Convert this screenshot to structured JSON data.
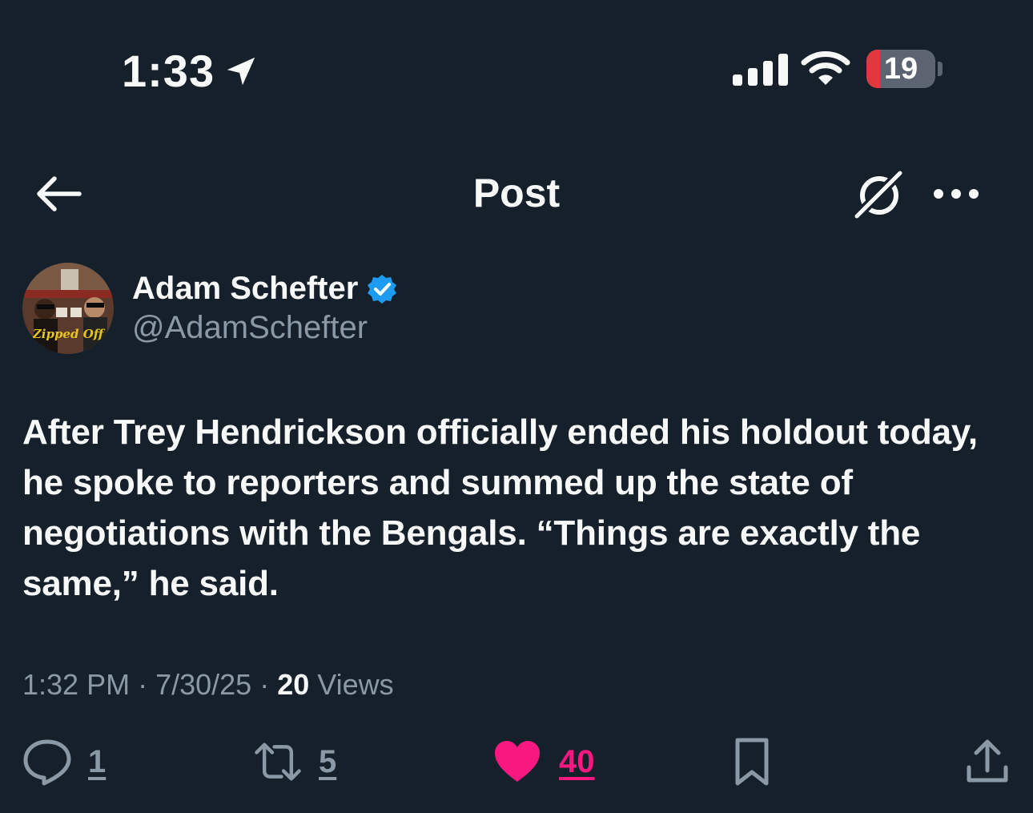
{
  "status_bar": {
    "time": "1:33",
    "battery_level": "19",
    "icons": [
      "location-arrow-icon",
      "cellular-signal-icon",
      "wifi-icon",
      "battery-icon"
    ]
  },
  "header": {
    "title": "Post",
    "icons": [
      "back-arrow-icon",
      "grok-icon",
      "more-options-icon"
    ]
  },
  "author": {
    "name": "Adam Schefter",
    "handle": "@AdamSchefter",
    "verified": true,
    "avatar_caption": "Zipped Off"
  },
  "post": {
    "text": "After Trey Hendrickson officially ended his holdout today, he spoke to reporters and summed up the state of negotiations with the Bengals. “Things are exactly the same,” he said.",
    "time": "1:32 PM",
    "date": "7/30/25",
    "views_count": "20",
    "views_label": "Views",
    "separator": "·"
  },
  "actions": {
    "replies": "1",
    "reposts": "5",
    "likes": "40"
  },
  "colors": {
    "background": "#15202b",
    "text": "#f7f9f9",
    "secondary_text": "#8b98a5",
    "verified": "#1d9bf0",
    "like": "#f91880"
  }
}
